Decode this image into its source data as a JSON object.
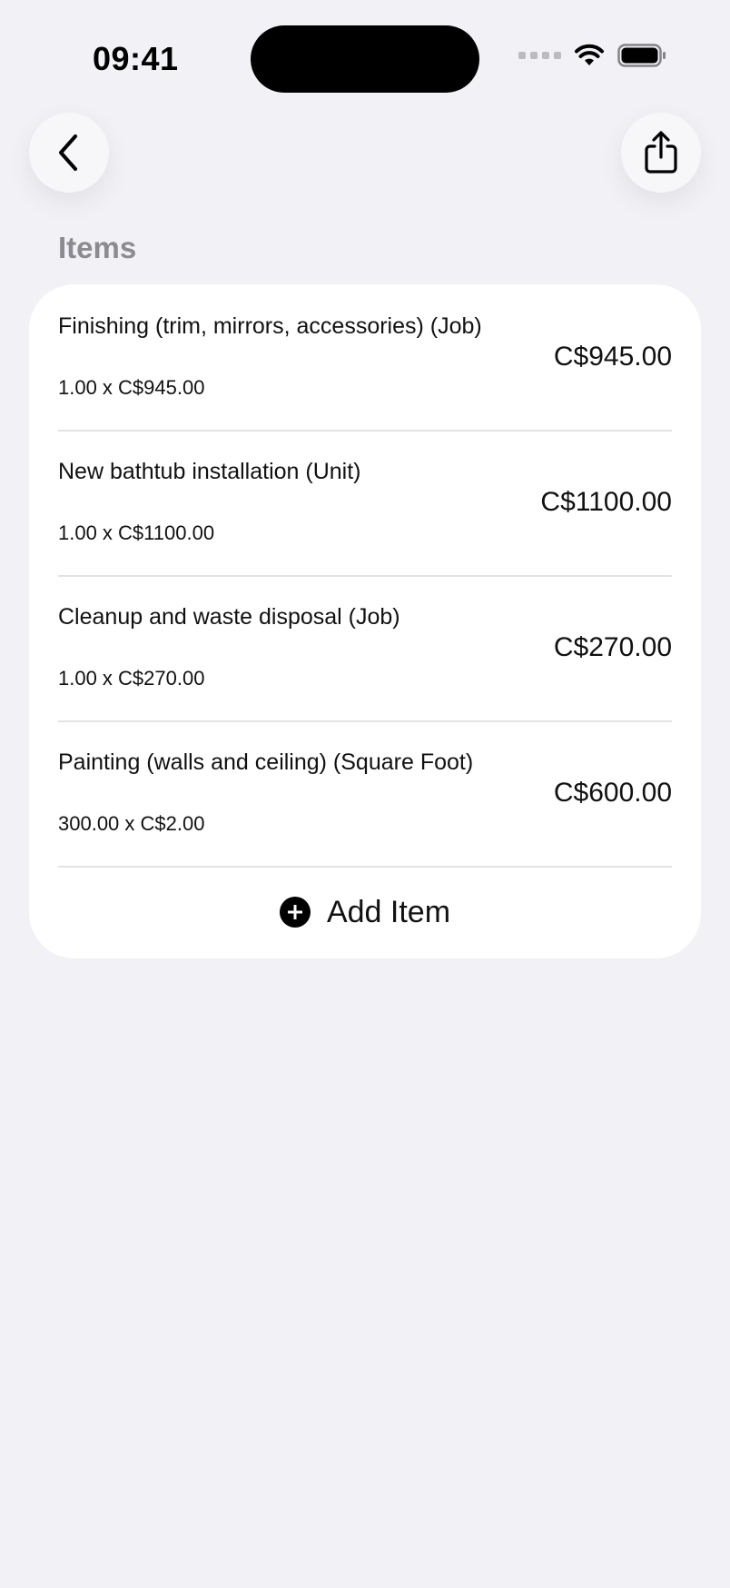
{
  "status_bar": {
    "time": "09:41"
  },
  "header": {
    "back_icon": "chevron-left-icon",
    "share_icon": "share-icon"
  },
  "section": {
    "title": "Items"
  },
  "items": [
    {
      "name": "Finishing (trim, mirrors, accessories) (Job)",
      "detail": "1.00 x C$945.00",
      "total": "C$945.00"
    },
    {
      "name": "New bathtub installation (Unit)",
      "detail": "1.00 x C$1100.00",
      "total": "C$1100.00"
    },
    {
      "name": "Cleanup and waste disposal (Job)",
      "detail": "1.00 x C$270.00",
      "total": "C$270.00"
    },
    {
      "name": "Painting (walls and ceiling) (Square Foot)",
      "detail": "300.00 x C$2.00",
      "total": "C$600.00"
    }
  ],
  "add_item": {
    "label": "Add Item",
    "icon": "plus-circle-icon"
  }
}
